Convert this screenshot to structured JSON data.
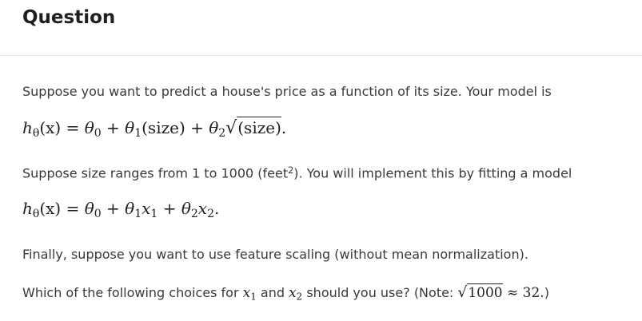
{
  "header": {
    "title": "Question"
  },
  "question": {
    "p1": "Suppose you want to predict a house's price as a function of its size. Your model is",
    "eq1": {
      "h": "h",
      "theta_sub": "θ",
      "x": "(x)",
      "eq_sign": "=",
      "t0": "θ",
      "t0_sub": "0",
      "plus1": "+",
      "t1": "θ",
      "t1_sub": "1",
      "size": "(size)",
      "plus2": "+",
      "t2": "θ",
      "t2_sub": "2",
      "sqrt_sign": "√",
      "sqrt_arg": "(size)",
      "end": "."
    },
    "p2_before": "Suppose size ranges from 1 to 1000 (feet",
    "p2_sup": "2",
    "p2_after": "). You will implement this by fitting a model",
    "eq2": {
      "h": "h",
      "theta_sub": "θ",
      "x": "(x)",
      "eq_sign": "=",
      "t0": "θ",
      "t0_sub": "0",
      "plus1": "+",
      "t1": "θ",
      "t1_sub": "1",
      "x1": "x",
      "x1_sub": "1",
      "plus2": "+",
      "t2": "θ",
      "t2_sub": "2",
      "x2": "x",
      "x2_sub": "2",
      "end": "."
    },
    "p3": "Finally, suppose you want to use feature scaling (without mean normalization).",
    "p4_part1": "Which of the following choices for ",
    "p4_x1": "x",
    "p4_x1_sub": "1",
    "p4_and": " and ",
    "p4_x2": "x",
    "p4_x2_sub": "2",
    "p4_part2": " should you use? (Note: ",
    "p4_sqrt_sign": "√",
    "p4_sqrt_arg": "1000",
    "p4_approx": " ≈ 32.",
    "p4_end": ")"
  }
}
